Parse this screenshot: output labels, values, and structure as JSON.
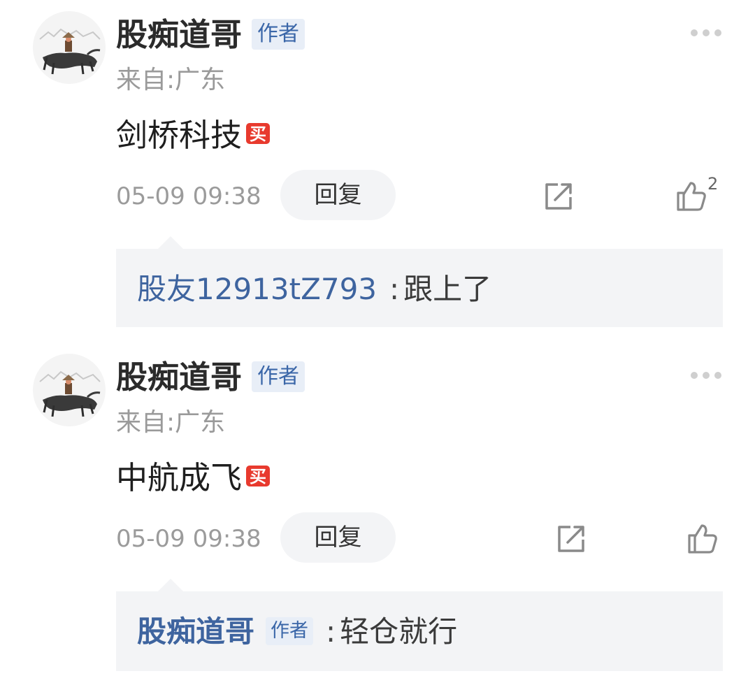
{
  "comments": [
    {
      "username": "股痴道哥",
      "author_badge": "作者",
      "location": "来自:广东",
      "content": "剑桥科技",
      "buy_badge": "买",
      "timestamp": "05-09 09:38",
      "reply_label": "回复",
      "like_count": "2",
      "reply": {
        "user": "股友12913tZ793",
        "separator": ":",
        "text": "跟上了",
        "author_badge": ""
      }
    },
    {
      "username": "股痴道哥",
      "author_badge": "作者",
      "location": "来自:广东",
      "content": "中航成飞",
      "buy_badge": "买",
      "timestamp": "05-09 09:38",
      "reply_label": "回复",
      "like_count": "",
      "reply": {
        "user": "股痴道哥",
        "separator": ":",
        "text": "轻仓就行",
        "author_badge": "作者"
      }
    }
  ],
  "icons": {
    "more": "more-dots-icon",
    "share": "share-icon",
    "like": "thumbs-up-icon",
    "badge_color": "#e83a2e",
    "accent_blue": "#3e649f"
  }
}
